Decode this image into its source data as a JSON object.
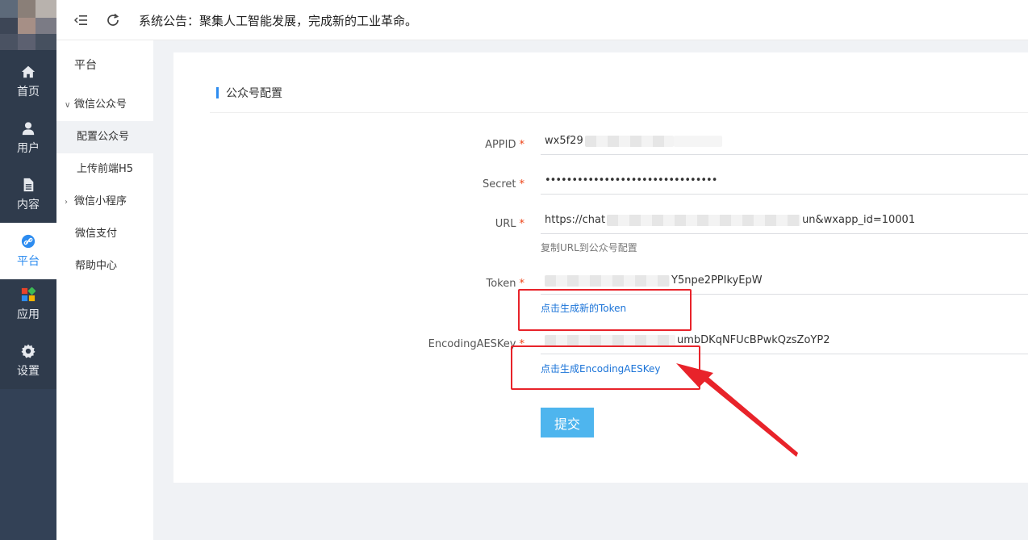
{
  "header": {
    "notice": "系统公告：聚集人工智能发展，完成新的工业革命。",
    "menu_toggle_icon": "menu-fold-icon",
    "refresh_icon": "refresh-icon"
  },
  "rail": {
    "items": [
      {
        "label": "首页",
        "icon": "home-icon"
      },
      {
        "label": "用户",
        "icon": "user-icon"
      },
      {
        "label": "内容",
        "icon": "document-icon"
      },
      {
        "label": "平台",
        "icon": "link-icon"
      },
      {
        "label": "应用",
        "icon": "apps-icon"
      },
      {
        "label": "设置",
        "icon": "gear-icon"
      }
    ],
    "active": "平台"
  },
  "submenu": {
    "title": "平台",
    "items": [
      {
        "label": "微信公众号"
      },
      {
        "label": "配置公众号"
      },
      {
        "label": "上传前端H5"
      },
      {
        "label": "微信小程序"
      },
      {
        "label": "微信支付"
      },
      {
        "label": "帮助中心"
      }
    ]
  },
  "card": {
    "title": "公众号配置",
    "required_mark": "*",
    "fields": {
      "appid": {
        "label": "APPID",
        "value": "wx5f29"
      },
      "secret": {
        "label": "Secret",
        "value": "••••••••••••••••••••••••••••••••"
      },
      "url": {
        "label": "URL",
        "value_start": "https://chat",
        "value_end": "un&wxapp_id=10001",
        "hint": "复制URL到公众号配置"
      },
      "token": {
        "label": "Token",
        "value_end": "Y5npe2PPIkyEpW",
        "hint": "点击生成新的Token"
      },
      "aeskey": {
        "label": "EncodingAESKey",
        "value_end": "umbDKqNFUcBPwkQzsZoYP2",
        "hint": "点击生成EncodingAESKey"
      }
    },
    "submit_label": "提交"
  },
  "colors": {
    "rail_bg": "#2f3b4c",
    "accent": "#2d8cf0",
    "submit": "#4eb5ee",
    "annotation": "#e8232a"
  }
}
